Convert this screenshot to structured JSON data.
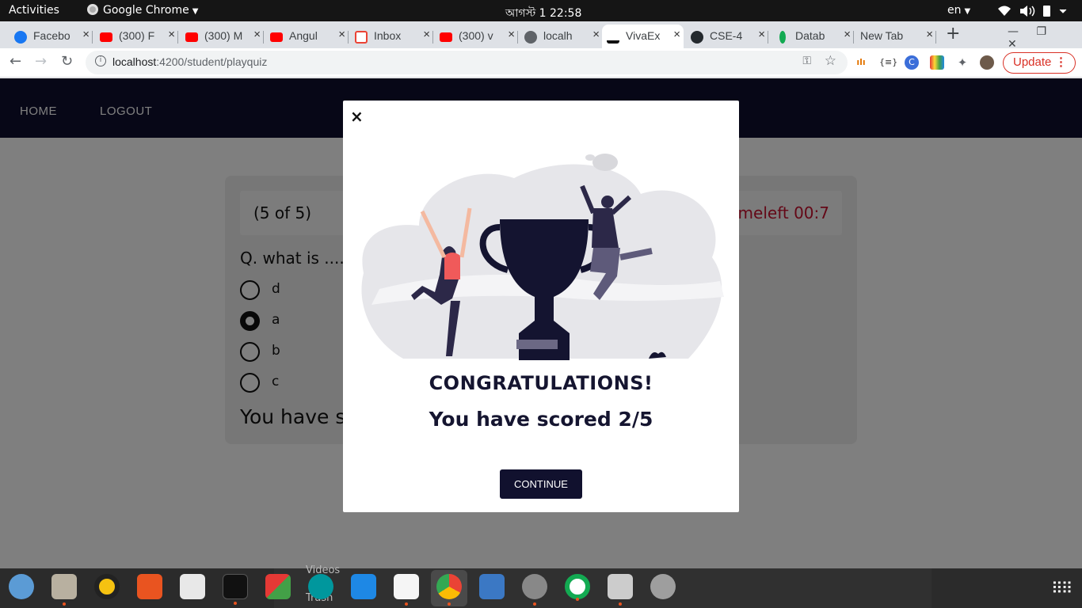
{
  "topbar": {
    "activities": "Activities",
    "app_name": "Google Chrome",
    "clock": "আগস্ট 1  22:58",
    "lang": "en"
  },
  "tabs": [
    {
      "label": "Facebo",
      "icon": "facebook-icon",
      "color": "#1877f2"
    },
    {
      "label": "(300) F",
      "icon": "youtube-icon",
      "color": "#ff0000"
    },
    {
      "label": "(300) M",
      "icon": "youtube-icon",
      "color": "#ff0000"
    },
    {
      "label": "Angul",
      "icon": "youtube-icon",
      "color": "#ff0000"
    },
    {
      "label": "Inbox",
      "icon": "gmail-icon",
      "color": "#ea4335"
    },
    {
      "label": "(300) v",
      "icon": "youtube-icon",
      "color": "#ff0000"
    },
    {
      "label": "localh",
      "icon": "globe-icon",
      "color": "#5f6368"
    },
    {
      "label": "VivaEx",
      "icon": "viva-icon",
      "color": "#111111"
    },
    {
      "label": "CSE-4",
      "icon": "github-icon",
      "color": "#24292e"
    },
    {
      "label": "Datab",
      "icon": "mongodb-icon",
      "color": "#13aa52"
    },
    {
      "label": "New Tab",
      "icon": "",
      "color": ""
    }
  ],
  "toolbar": {
    "url_host": "localhost",
    "url_rest": ":4200/student/playquiz",
    "update_label": "Update"
  },
  "site": {
    "nav_home": "HOME",
    "nav_logout": "LOGOUT",
    "question_count": "(5 of 5)",
    "time_left": "meleft 00:7",
    "question": "Q. what is .......",
    "options": [
      {
        "label": "d",
        "selected": false
      },
      {
        "label": "a",
        "selected": true
      },
      {
        "label": "b",
        "selected": false
      },
      {
        "label": "c",
        "selected": false
      }
    ],
    "score_line": "You have sc"
  },
  "modal": {
    "close": "×",
    "title": "CONGRATULATIONS!",
    "score": "You have scored 2/5",
    "continue_label": "CONTINUE"
  },
  "dock": {
    "files_peek_1": "Videos",
    "files_peek_2": "Trash"
  },
  "colors": {
    "nav_bg": "#0f0f2e",
    "accent_red": "#c8102e",
    "button_bg": "#11112e"
  }
}
